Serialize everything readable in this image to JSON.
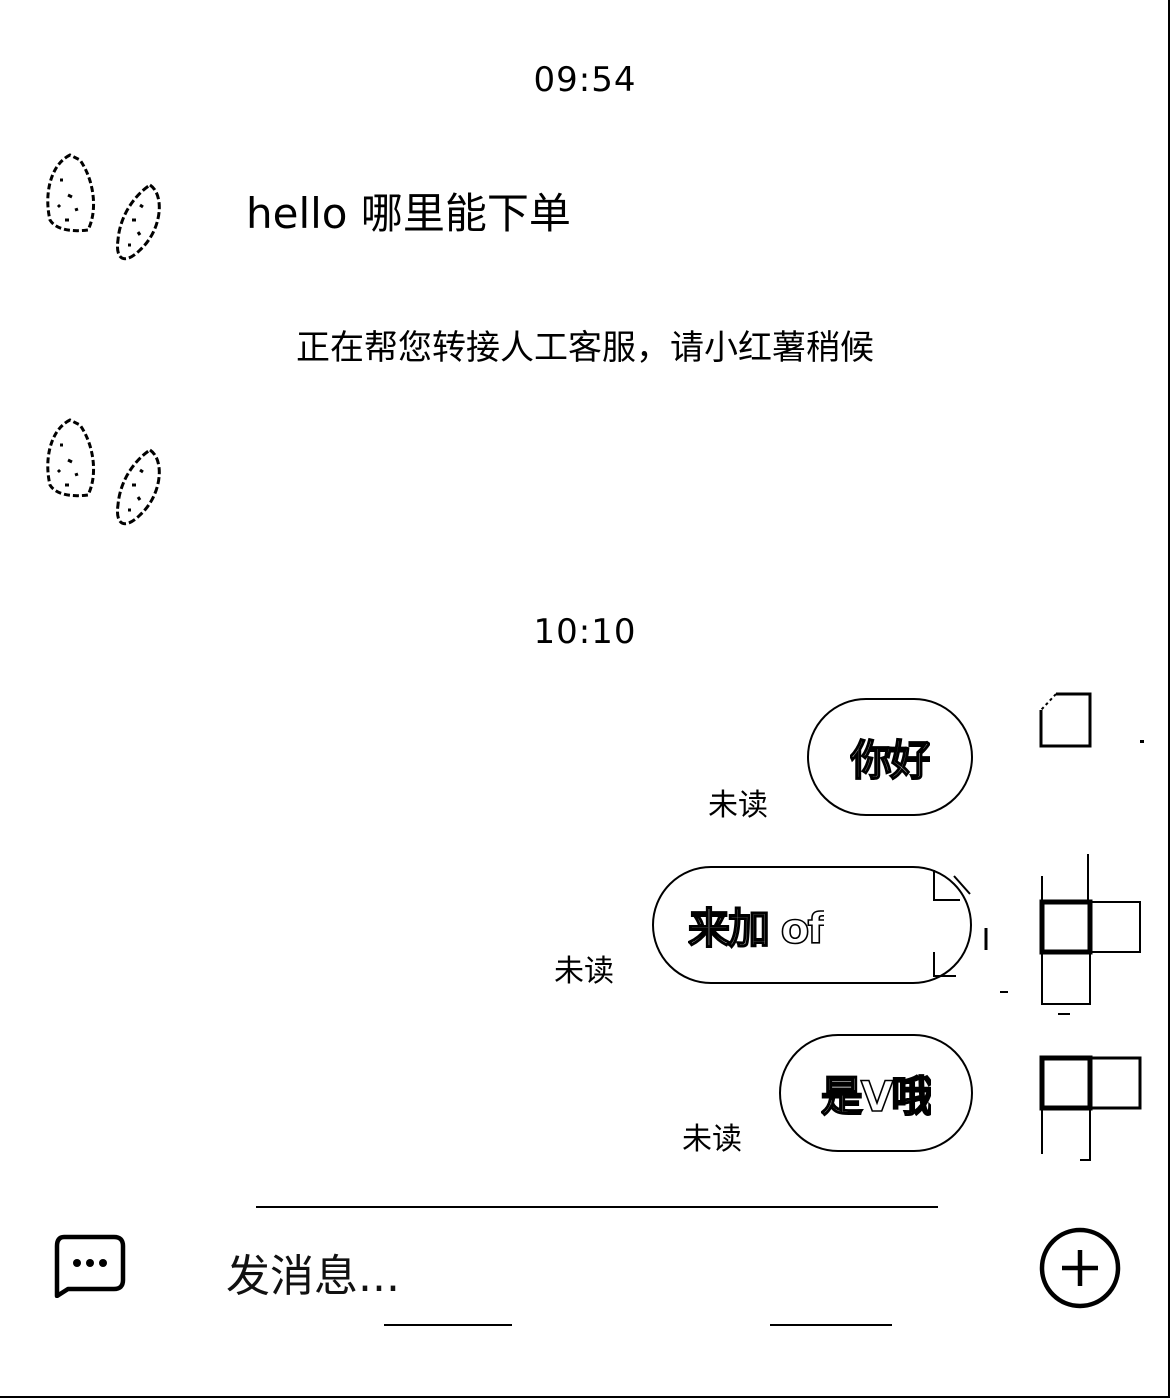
{
  "timestamps": [
    "09:54",
    "10:10"
  ],
  "incoming": {
    "text": "hello 哪里能下单"
  },
  "system": {
    "text": "正在帮您转接人工客服，请小红薯稍候"
  },
  "outgoing": [
    {
      "text": "你好",
      "status": "未读"
    },
    {
      "text": "来加 of",
      "status": "未读"
    },
    {
      "text": "是V哦",
      "status": "未读"
    }
  ],
  "composer": {
    "placeholder": "发消息..."
  },
  "icons": {
    "message": "chat-bubble-icon",
    "add": "plus-circle-icon",
    "avatar": "leaf-avatar-icon"
  }
}
